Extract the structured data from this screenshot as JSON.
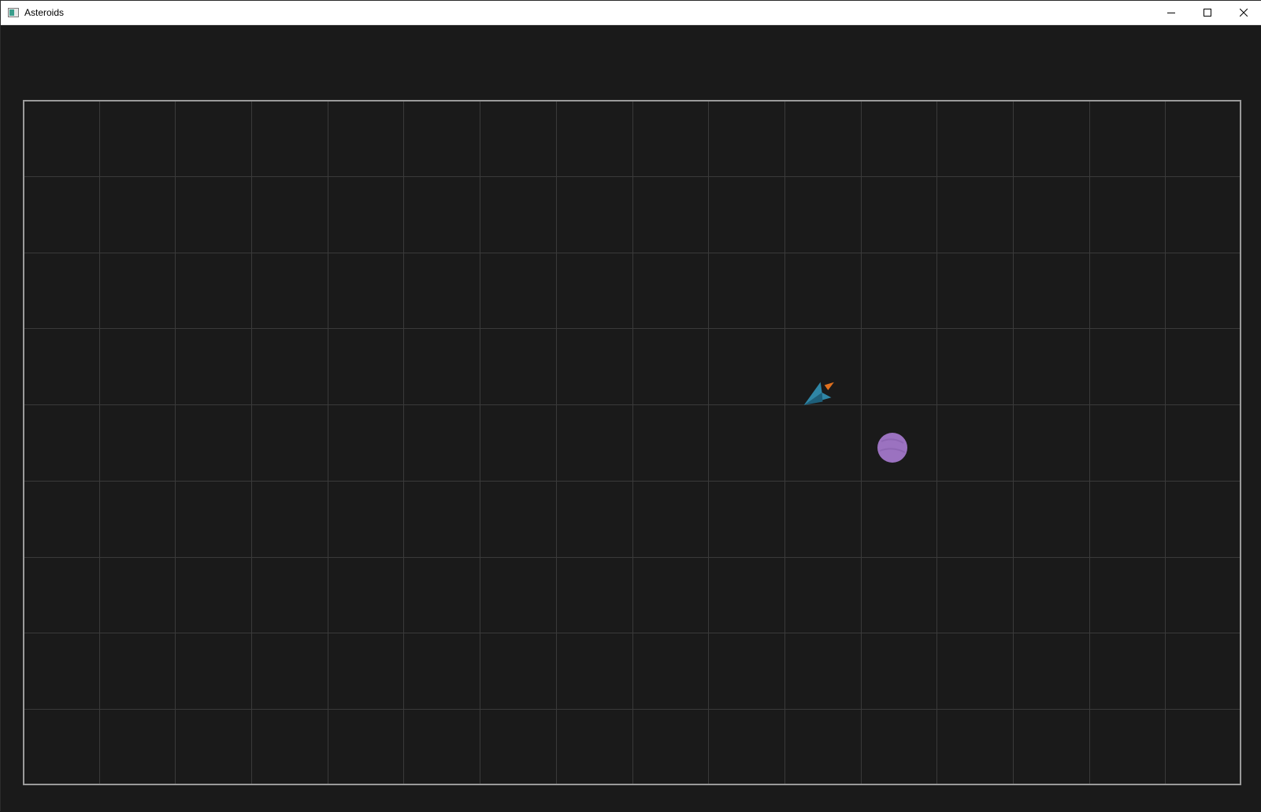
{
  "window": {
    "title": "Asteroids",
    "controls": {
      "minimize": "minimize-icon",
      "maximize": "maximize-icon",
      "close": "close-icon"
    }
  },
  "game": {
    "grid": {
      "columns": 16,
      "rows": 9
    },
    "colors": {
      "background": "#1a1a1a",
      "grid_line": "#3a3a3a",
      "border": "#9a9a9a",
      "ship_body": "#2f86a6",
      "ship_dark": "#1e5f7a",
      "ship_flame": "#e0701e",
      "asteroid": "#9b72c0",
      "asteroid_shade": "#7e58a3"
    },
    "entities": [
      {
        "type": "ship",
        "icon": "spaceship-icon"
      },
      {
        "type": "asteroid",
        "icon": "asteroid-icon"
      }
    ]
  }
}
